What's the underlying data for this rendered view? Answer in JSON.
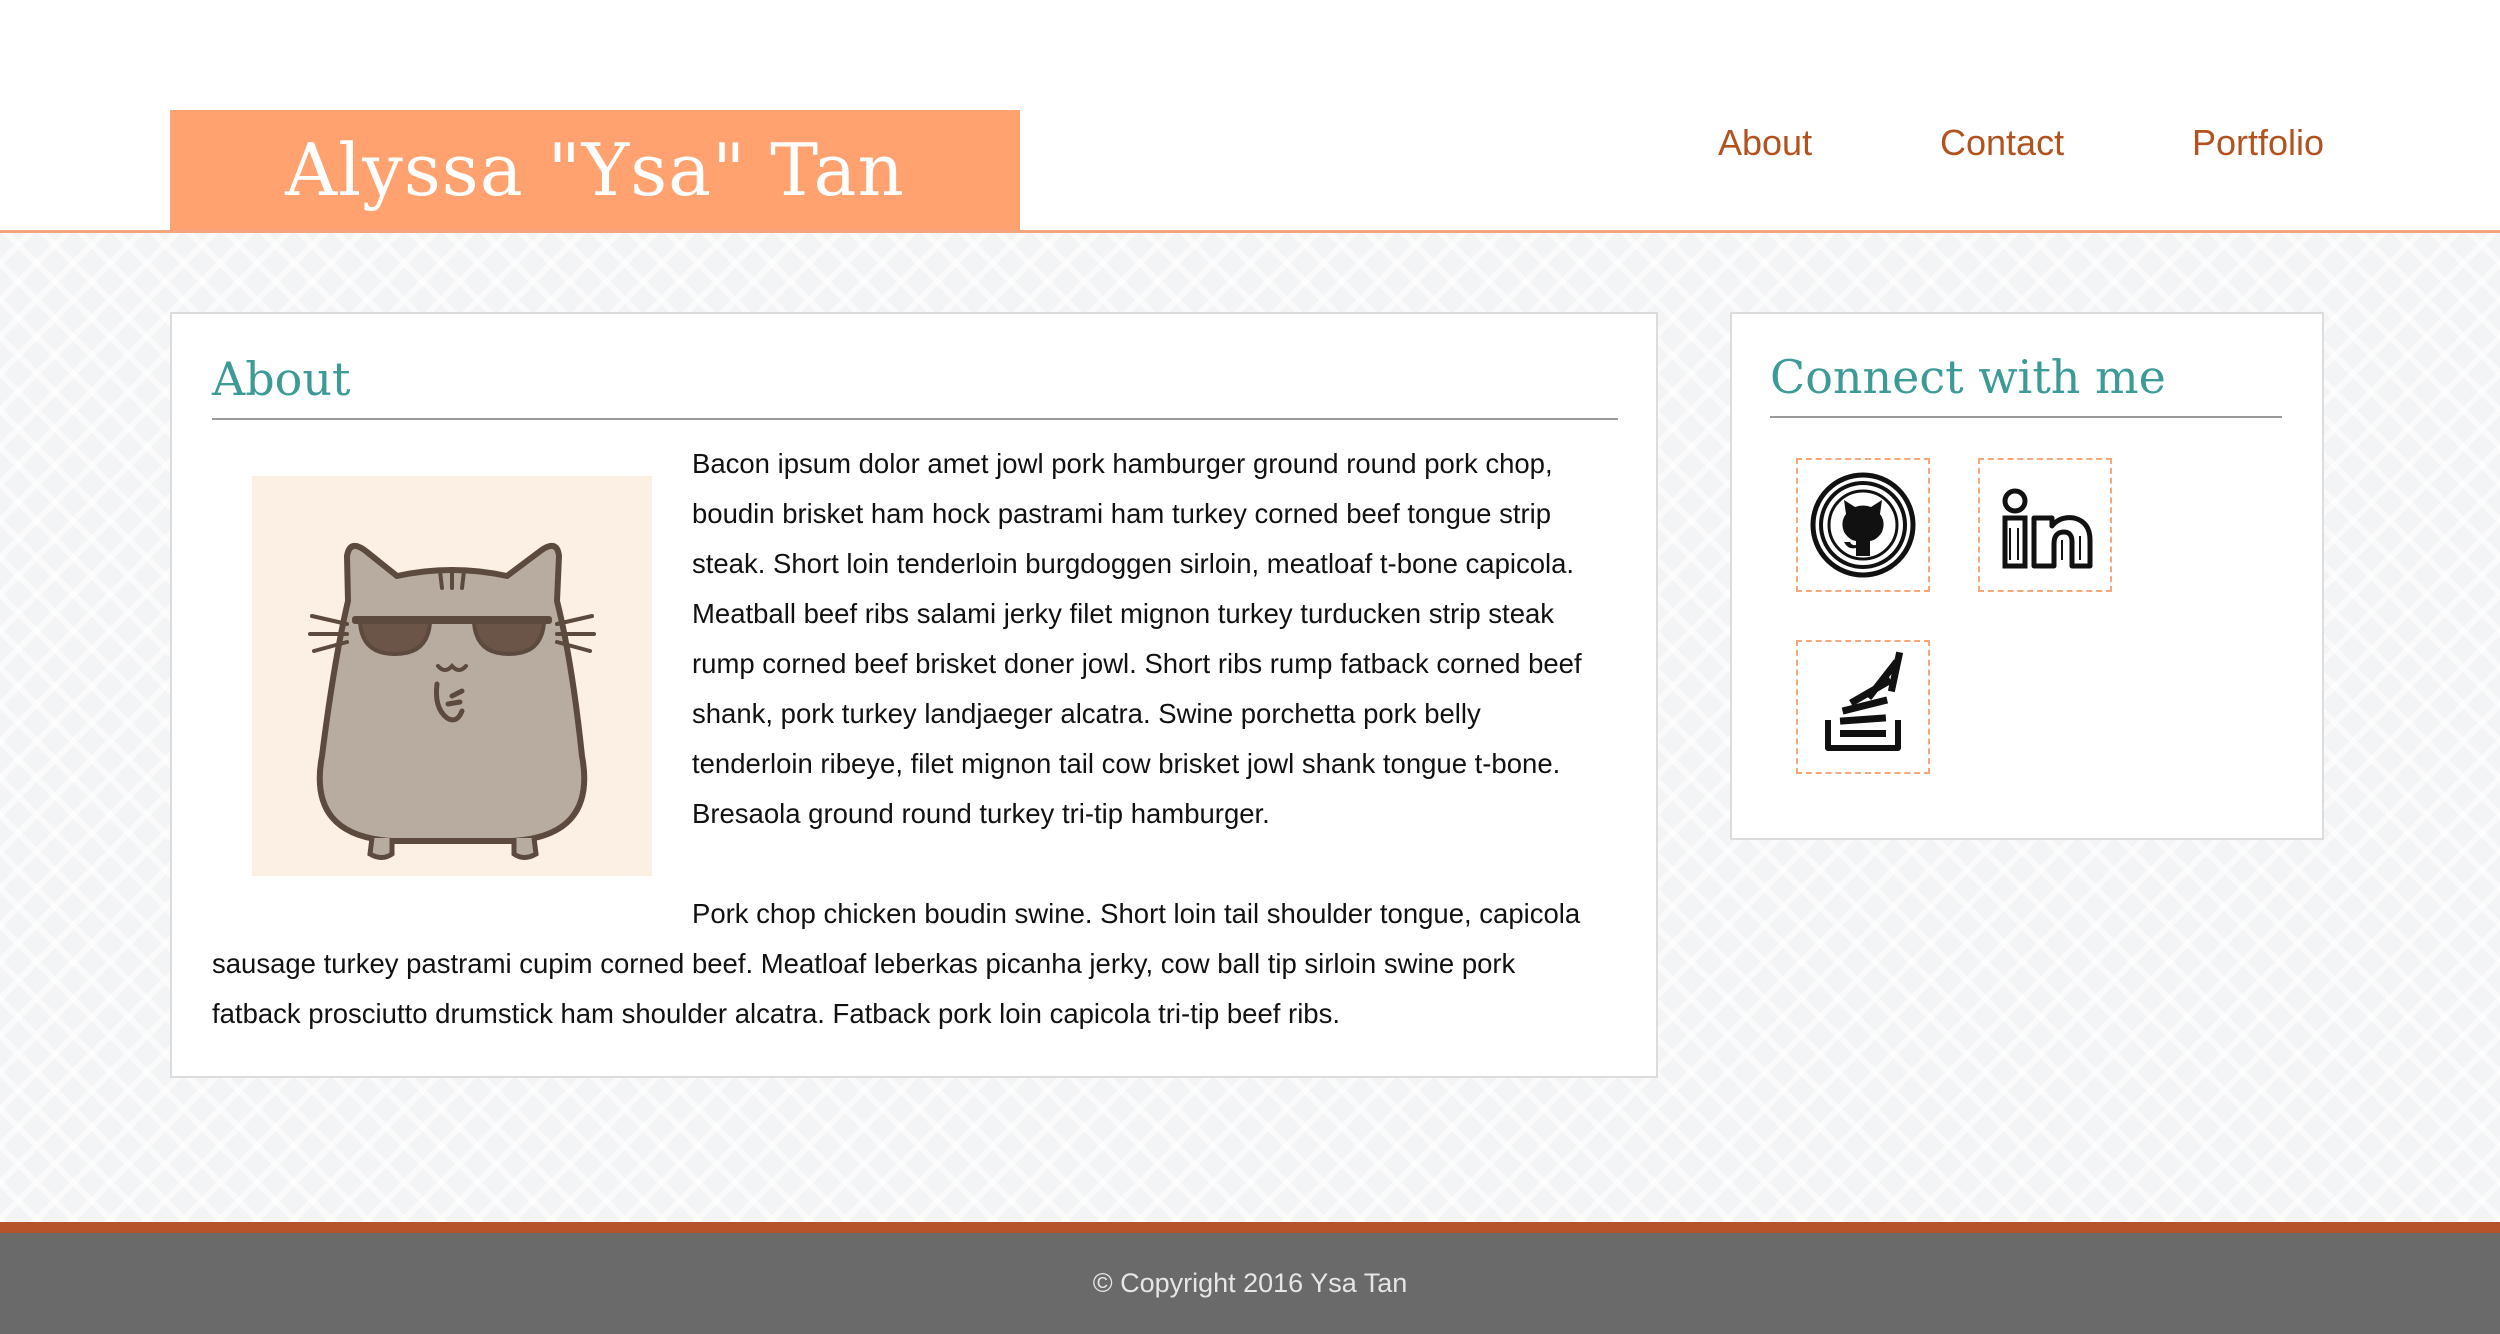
{
  "header": {
    "brand": "Alyssa \"Ysa\" Tan",
    "nav": [
      "About",
      "Contact",
      "Portfolio"
    ]
  },
  "about": {
    "title": "About",
    "para1_lines": [
      "Bacon ipsum dolor amet jowl pork hamburger ground round pork chop,",
      "boudin brisket ham hock pastrami ham turkey corned beef tongue strip",
      "steak. Short loin tenderloin burgdoggen sirloin, meatloaf t-bone capicola.",
      "Meatball beef ribs salami jerky filet mignon turkey turducken strip steak",
      "rump corned beef brisket doner jowl. Short ribs rump fatback corned beef",
      "shank, pork turkey landjaeger alcatra. Swine porchetta pork belly",
      "tenderloin ribeye, filet mignon tail cow brisket jowl shank tongue t-bone.",
      "Bresaola ground round turkey tri-tip hamburger."
    ],
    "para2_lines": [
      "Pork chop chicken boudin swine. Short loin tail shoulder tongue, capicola",
      "sausage turkey pastrami cupim corned beef. Meatloaf leberkas picanha jerky, cow ball tip sirloin swine pork",
      "fatback prosciutto drumstick ham shoulder alcatra. Fatback pork loin capicola tri-tip beef ribs."
    ],
    "image": "pusheen-cat-sunglasses"
  },
  "connect": {
    "title": "Connect with me",
    "icons": [
      "github-icon",
      "linkedin-icon",
      "stackoverflow-icon"
    ]
  },
  "footer": {
    "copyright": "© Copyright 2016 Ysa Tan"
  },
  "colors": {
    "brand_bg": "#ffa26f",
    "nav_link": "#b2531f",
    "heading": "#3c9b97",
    "footer_bg": "#6a6a6a",
    "footer_stripe": "#b6532a"
  }
}
